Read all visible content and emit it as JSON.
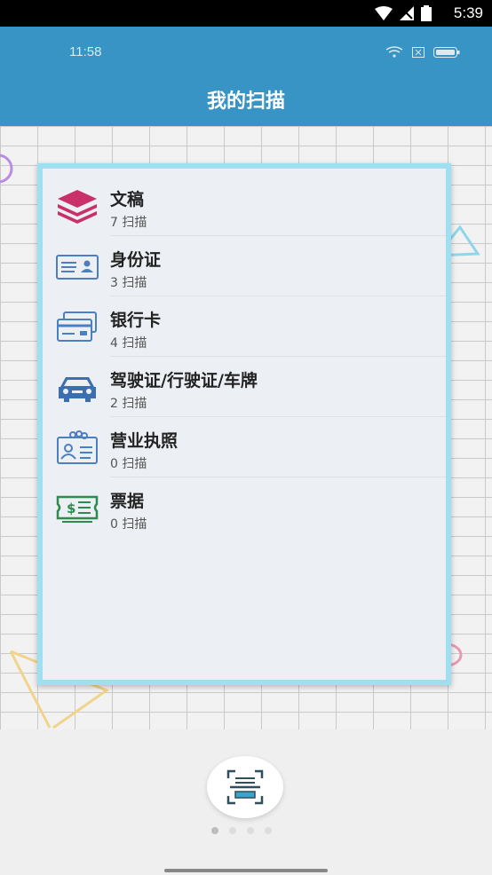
{
  "status_bar": {
    "time": "5:39"
  },
  "header": {
    "inner_time": "11:58",
    "title": "我的扫描"
  },
  "items": [
    {
      "label": "文稿",
      "count": "7 扫描",
      "icon": "layers-icon",
      "color": "#c9306a"
    },
    {
      "label": "身份证",
      "count": "3 扫描",
      "icon": "id-card-icon",
      "color": "#4a7fc1"
    },
    {
      "label": "银行卡",
      "count": "4 扫描",
      "icon": "bank-card-icon",
      "color": "#4a7fc1"
    },
    {
      "label": "驾驶证/行驶证/车牌",
      "count": "2 扫描",
      "icon": "car-icon",
      "color": "#3b6fb0"
    },
    {
      "label": "营业执照",
      "count": "0 扫描",
      "icon": "business-license-icon",
      "color": "#4a7fc1"
    },
    {
      "label": "票据",
      "count": "0 扫描",
      "icon": "receipt-icon",
      "color": "#2f8a4f"
    }
  ],
  "fab": {
    "icon": "scan-icon"
  },
  "pager": {
    "pages": 4,
    "active": 1
  }
}
